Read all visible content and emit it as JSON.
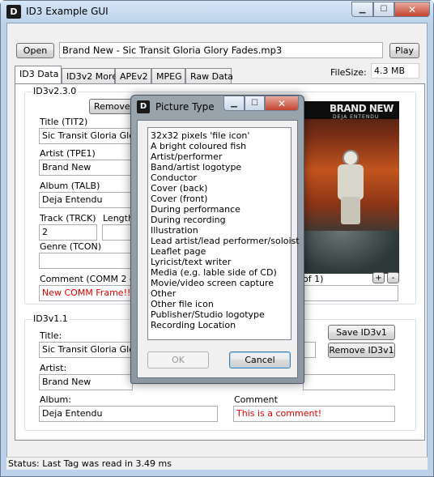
{
  "window": {
    "title": "ID3 Example GUI",
    "icon": "id3-app-icon"
  },
  "toolbar": {
    "open_label": "Open",
    "file_path": "Brand New - Sic Transit Gloria  Glory Fades.mp3",
    "play_label": "Play"
  },
  "tabs": [
    {
      "label": "ID3 Data",
      "active": true
    },
    {
      "label": "ID3v2 More"
    },
    {
      "label": "APEv2"
    },
    {
      "label": "MPEG"
    },
    {
      "label": "Raw Data"
    }
  ],
  "filesize": {
    "label": "FileSize:",
    "value": "4.3 MB"
  },
  "id3v2": {
    "group_title": "ID3v2.3.0",
    "remove_label": "Remove I",
    "title_label": "Title (TIT2)",
    "title_value": "Sic Transit Gloria  Glory",
    "artist_label": "Artist (TPE1)",
    "artist_value": "Brand New",
    "album_label": "Album (TALB)",
    "album_value": "Deja Entendu",
    "track_label": "Track (TRCK)",
    "track_value": "2",
    "length_label": "Length",
    "genre_label": "Genre (TCON)",
    "genre_value": "",
    "comment_label": "Comment (COMM 2 of 2",
    "comment_value": "New COMM Frame!!",
    "picture_counter": "of 1)",
    "plus_label": "+",
    "minus_label": "-"
  },
  "album_art": {
    "band": "BRAND NEW",
    "album": "DEJA ENTENDU"
  },
  "id3v1": {
    "group_title": "ID3v1.1",
    "title_label": "Title:",
    "title_value": "Sic Transit Gloria  Glory",
    "artist_label": "Artist:",
    "artist_value": "Brand New",
    "album_label": "Album:",
    "album_value": "Deja Entendu",
    "comment_label": "Comment",
    "comment_value": "This is a comment!",
    "save_label": "Save ID3v1",
    "remove_label": "Remove ID3v1"
  },
  "status": {
    "text": "Status: Last Tag was read in 3.49 ms"
  },
  "dialog": {
    "title": "Picture Type",
    "items": [
      "32x32 pixels 'file icon'",
      "A bright coloured fish",
      "Artist/performer",
      "Band/artist logotype",
      "Conductor",
      "Cover (back)",
      "Cover (front)",
      "During performance",
      "During recording",
      "Illustration",
      "Lead artist/lead performer/soloist",
      "Leaflet page",
      "Lyricist/text writer",
      "Media (e.g. lable side of CD)",
      "Movie/video screen capture",
      "Other",
      "Other file icon",
      "Publisher/Studio logotype",
      "Recording Location"
    ],
    "ok_label": "OK",
    "cancel_label": "Cancel"
  },
  "colors": {
    "accent_red": "#e00000",
    "titlebar": "#bcd2ea",
    "close_button": "#c5442f"
  }
}
